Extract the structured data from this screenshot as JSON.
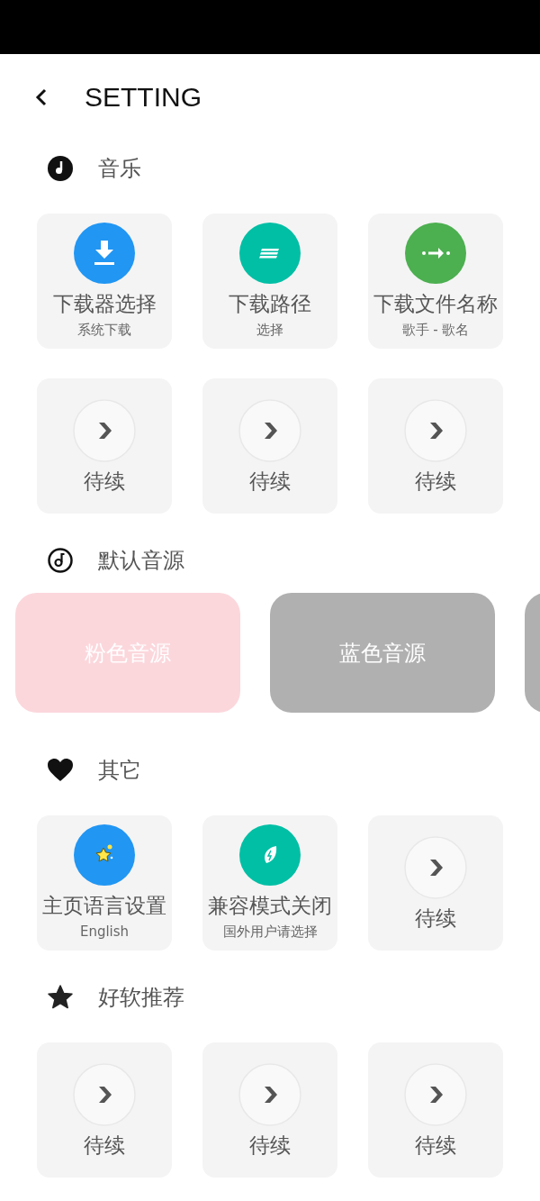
{
  "header": {
    "title": "SETTING"
  },
  "sections": [
    {
      "kind": "grid",
      "title": "音乐",
      "items": [
        {
          "kind": "download",
          "color": "#2196f3",
          "label": "下载器选择",
          "sub": "系统下载"
        },
        {
          "kind": "lines",
          "color": "#00bfa5",
          "label": "下载路径",
          "sub": "选择"
        },
        {
          "kind": "arrow",
          "color": "#4caf50",
          "label": "下载文件名称",
          "sub": "歌手 - 歌名"
        },
        {
          "kind": "next",
          "label": "待续"
        },
        {
          "kind": "next",
          "label": "待续"
        },
        {
          "kind": "next",
          "label": "待续"
        }
      ]
    },
    {
      "kind": "sources",
      "title": "默认音源",
      "items": [
        {
          "label": "粉色音源",
          "color": "#fbd7dc"
        },
        {
          "label": "蓝色音源",
          "color": "#b0b0b0"
        },
        {
          "color": "#b0b0b0"
        }
      ]
    },
    {
      "kind": "grid",
      "title": "其它",
      "items": [
        {
          "kind": "star",
          "color": "#2196f3",
          "label": "主页语言设置",
          "sub": "English"
        },
        {
          "kind": "leaf",
          "color": "#00bfa5",
          "label": "兼容模式关闭",
          "sub": "国外用户请选择"
        },
        {
          "kind": "next",
          "label": "待续"
        }
      ]
    },
    {
      "kind": "grid",
      "title": "好软推荐",
      "items": [
        {
          "kind": "next",
          "label": "待续"
        },
        {
          "kind": "next",
          "label": "待续"
        },
        {
          "kind": "next",
          "label": "待续"
        }
      ]
    }
  ]
}
